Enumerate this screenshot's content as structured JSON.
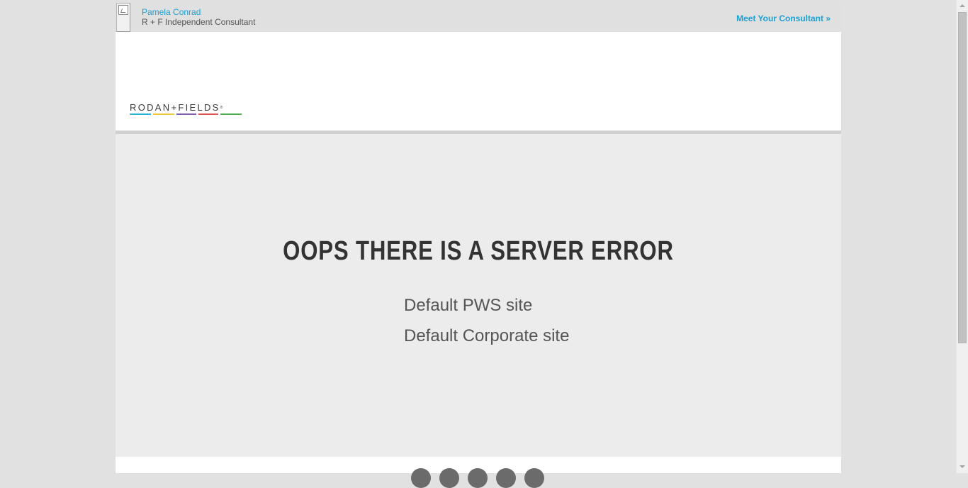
{
  "consultant": {
    "name": "Pamela Conrad",
    "title": "R + F Independent Consultant",
    "meet_link": "Meet Your Consultant »"
  },
  "logo": {
    "text": "RODAN+FIELDS",
    "stripe_colors": [
      "#29b4d6",
      "#f0c93a",
      "#7c5ca8",
      "#d9534f",
      "#4cae4c"
    ]
  },
  "error": {
    "title": "OOPS THERE IS A SERVER ERROR",
    "pws_link": "Default PWS site",
    "corporate_link": "Default Corporate site"
  },
  "colors": {
    "link_blue": "#1aa0d3",
    "page_bg": "#e1e1e1",
    "content_bg": "#ececec"
  },
  "footer": {
    "social_icons": [
      "facebook-icon",
      "twitter-icon",
      "pinterest-icon",
      "youtube-icon",
      "instagram-icon"
    ]
  }
}
